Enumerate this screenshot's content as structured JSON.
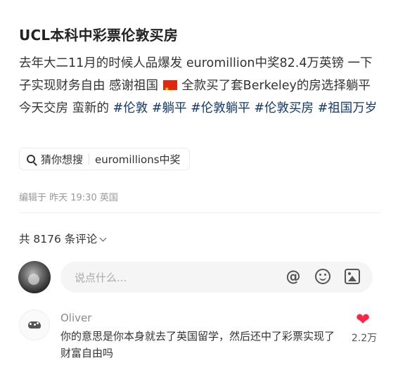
{
  "post": {
    "title": "UCL本科中彩票伦敦买房",
    "body_line1": "去年大二11月的时候人品爆发 euromillion中奖82.4万英镑 一下子实现财务自由 感谢祖国 ",
    "body_line2": " 全款买了套Berkeley的房选择躺平 今天交房 蛮新的 ",
    "tags": [
      "#伦敦",
      "#躺平",
      "#伦敦躺平",
      "#伦敦买房",
      "#祖国万岁"
    ],
    "flag_icon": "china-flag-icon",
    "edited_meta": "编辑于 昨天 19:30 英国"
  },
  "guess_search": {
    "label": "猜你想搜",
    "query": "euromillions中奖",
    "icon": "search-icon"
  },
  "comments_header": {
    "count_label": "共 8176 条评论"
  },
  "comment_input": {
    "placeholder": "说点什么...",
    "icons": [
      "at-icon",
      "emoji-icon",
      "image-icon"
    ]
  },
  "comments": [
    {
      "author": "Oliver",
      "text": "你的意思是你本身就去了英国留学，然后还中了彩票实现了财富自由吗",
      "likes": "2.2万",
      "liked": true
    }
  ],
  "colors": {
    "tag": "#13386c",
    "like": "#ff2442",
    "meta": "#999999"
  }
}
